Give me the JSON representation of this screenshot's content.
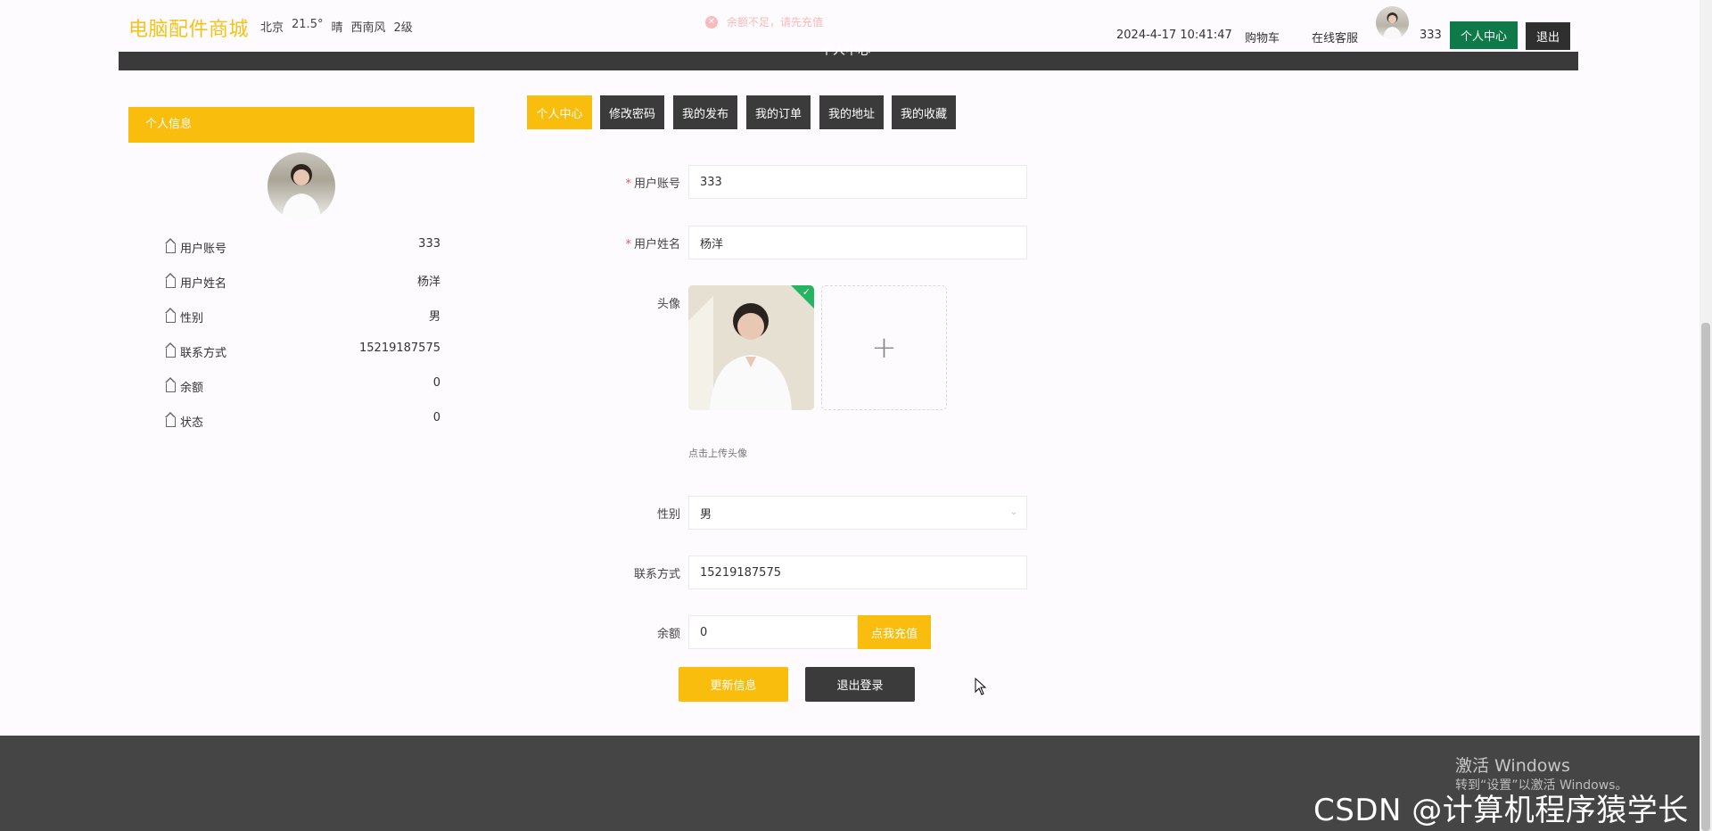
{
  "header": {
    "brand": "电脑配件商城",
    "weather": {
      "city": "北京",
      "temperature": "21.5°",
      "condition": "晴",
      "wind": "西南风",
      "level": "2级"
    },
    "toast": "余额不足，请先充值",
    "datetime": "2024-4-17 10:41:47",
    "cart_label": "购物车",
    "service_label": "在线客服",
    "username": "333",
    "center_button": "个人中心",
    "logout_button": "退出",
    "banner_title": "个人中心"
  },
  "sidebar": {
    "title": "个人信息",
    "items": [
      {
        "label": "用户账号",
        "value": "333"
      },
      {
        "label": "用户姓名",
        "value": "杨洋"
      },
      {
        "label": "性别",
        "value": "男"
      },
      {
        "label": "联系方式",
        "value": "15219187575"
      },
      {
        "label": "余额",
        "value": "0"
      },
      {
        "label": "状态",
        "value": "0"
      }
    ]
  },
  "tabs": [
    {
      "label": "个人中心",
      "active": true
    },
    {
      "label": "修改密码"
    },
    {
      "label": "我的发布"
    },
    {
      "label": "我的订单"
    },
    {
      "label": "我的地址"
    },
    {
      "label": "我的收藏"
    }
  ],
  "form": {
    "account_label": "用户账号",
    "account_value": "333",
    "name_label": "用户姓名",
    "name_value": "杨洋",
    "avatar_label": "头像",
    "avatar_hint": "点击上传头像",
    "gender_label": "性别",
    "gender_value": "男",
    "phone_label": "联系方式",
    "phone_value": "15219187575",
    "balance_label": "余额",
    "balance_value": "0",
    "recharge_button": "点我充值",
    "update_button": "更新信息",
    "exit_button": "退出登录"
  },
  "overlay": {
    "windows_line1": "激活 Windows",
    "windows_line2": "转到“设置”以激活 Windows。",
    "watermark": "CSDN @计算机程序猿学长"
  },
  "colors": {
    "accent": "#f8bd0d",
    "dark": "#3b3b3b",
    "green": "#0e7a49"
  }
}
